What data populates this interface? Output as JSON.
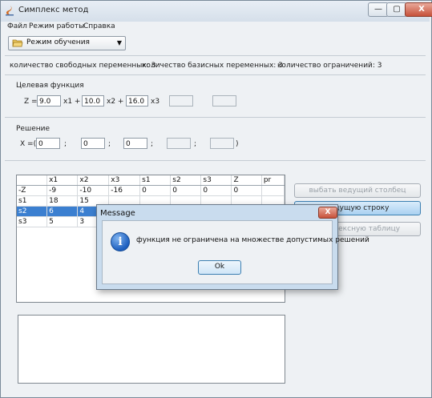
{
  "window": {
    "title": "Симплекс метод",
    "controls": {
      "minimize": "—",
      "maximize": "▢",
      "close": "X"
    }
  },
  "menu": [
    "Файл",
    "Режим работы",
    "Справка"
  ],
  "mode_combo": {
    "value": "Режим обучения"
  },
  "counts": {
    "free_vars": "количество свободных переменных: 3",
    "basic_vars": "количество базисных переменных:  3",
    "constraints": "количество ограничений:  3"
  },
  "objective": {
    "section_label": "Целевая функция",
    "z_label": "Z =",
    "c1": "9.0",
    "x1_label": "x1 +",
    "c2": "10.0",
    "x2_label": "x2 +",
    "c3": "16.0",
    "x3_label": "x3"
  },
  "solution": {
    "section_label": "Решение",
    "x_label": "X =(",
    "v1": "0",
    "v2": "0",
    "v3": "0",
    "sep": ";",
    "close": ")"
  },
  "table": {
    "headers": [
      "",
      "x1",
      "x2",
      "x3",
      "s1",
      "s2",
      "s3",
      "Z",
      "pr"
    ],
    "rows": [
      [
        "-Z",
        "-9",
        "-10",
        "-16",
        "0",
        "0",
        "0",
        "0",
        ""
      ],
      [
        "s1",
        "18",
        "15",
        "",
        "",
        "",
        "",
        "",
        ""
      ],
      [
        "s2",
        "6",
        "4",
        "",
        "",
        "",
        "",
        "",
        ""
      ],
      [
        "s3",
        "5",
        "3",
        "",
        "",
        "",
        "",
        "",
        ""
      ]
    ],
    "selected_row": 2
  },
  "buttons": {
    "pivot_col": "выбать ведущий столбец",
    "pivot_row": "ведущую строку",
    "simplex_table": "симплексную таблицу"
  },
  "dialog": {
    "title": "Message",
    "close": "X",
    "icon": "info-icon",
    "message": "функция не ограничена на множестве допустимых решений",
    "ok": "Ok"
  },
  "colors": {
    "selection": "#3b7fd0",
    "dialog_frame": "#c9dcee",
    "close_red": "#c7513a"
  }
}
